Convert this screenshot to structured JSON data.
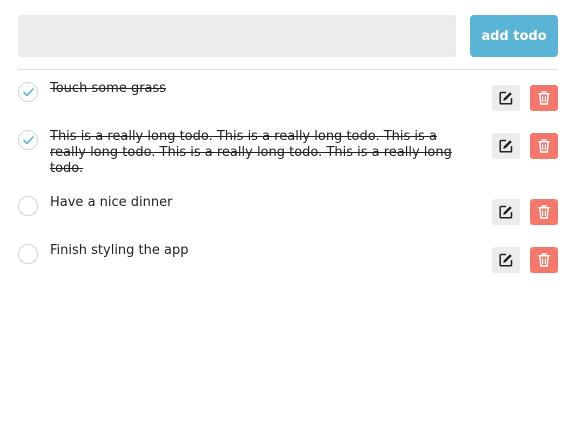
{
  "new_todo": {
    "value": "",
    "placeholder": "",
    "add_label": "add todo"
  },
  "colors": {
    "accent": "#5ab4d6",
    "delete": "#f4776b",
    "check": "#5ab4d6"
  },
  "icons": {
    "complete": "checkmark-icon",
    "edit": "edit-icon",
    "delete": "trash-icon"
  },
  "todos": [
    {
      "text": "Touch some grass",
      "completed": true
    },
    {
      "text": "This is a really long todo. This is a really long todo. This is a really long todo. This is a really long todo. This is a really long todo.",
      "completed": true
    },
    {
      "text": "Have a nice dinner",
      "completed": false
    },
    {
      "text": "Finish styling the app",
      "completed": false
    }
  ]
}
